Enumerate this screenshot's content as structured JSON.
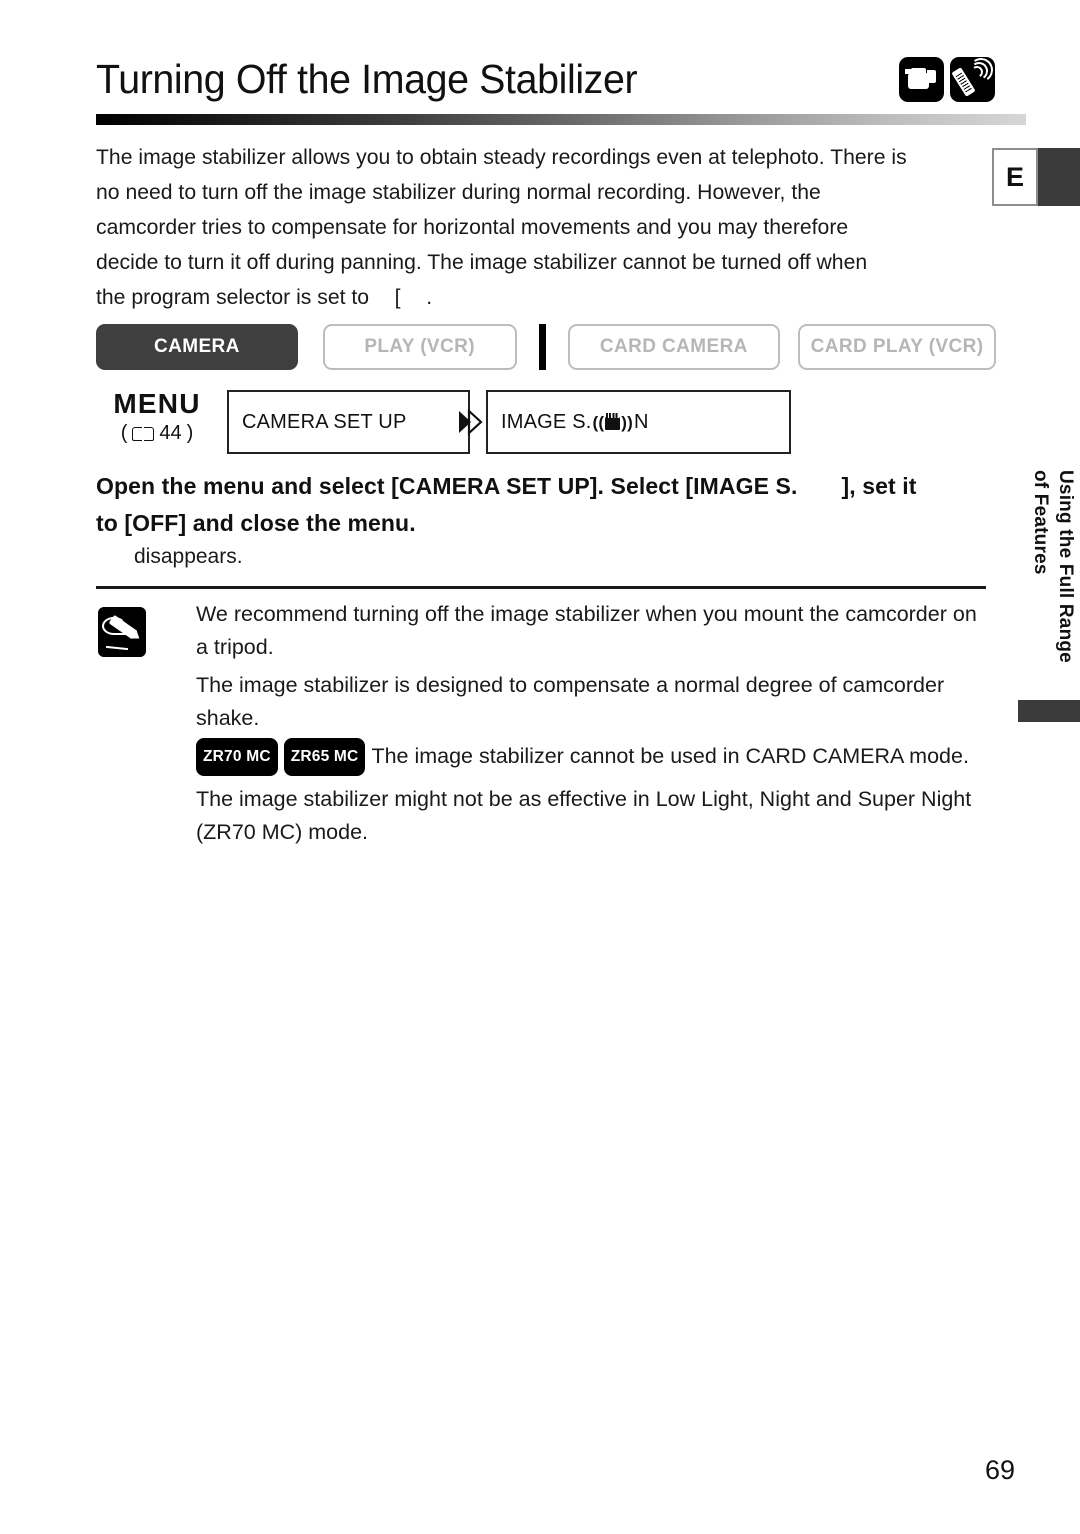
{
  "page": {
    "title": "Turning Off the Image Stabilizer",
    "number": "69",
    "language_tab": "E"
  },
  "title_icons": [
    {
      "name": "camcorder-icon",
      "label": "camcorder"
    },
    {
      "name": "remote-control-icon",
      "label": "wireless remote control"
    }
  ],
  "intro": {
    "line1": "The image stabilizer allows you to obtain steady recordings even at telephoto. There is",
    "line2": "no need to turn off the image stabilizer during normal recording. However, the",
    "line3": "camcorder tries to compensate for horizontal movements and you may therefore",
    "line4": "decide to turn it off during panning. The image stabilizer cannot be turned off when",
    "line5_before": "the program selector is set to",
    "line5_after": "[",
    "line5_end": "."
  },
  "mode_bar": {
    "modes": [
      {
        "label": "CAMERA",
        "state": "active"
      },
      {
        "label": "PLAY (VCR)",
        "state": "inactive"
      },
      {
        "label": "CARD CAMERA",
        "state": "inactive"
      },
      {
        "label": "CARD PLAY (VCR)",
        "state": "inactive"
      }
    ]
  },
  "menu": {
    "word": "MENU",
    "ref_open": "(",
    "ref_page": "44",
    "ref_close": ")",
    "box1": "CAMERA SET UP",
    "box2_before": "IMAGE S",
    "box2_dot": ".",
    "box2_after": "N"
  },
  "instruction": {
    "part1": "Open the menu and select [CAMERA SET UP]. Select [IMAGE S.",
    "part2": "], set it",
    "part3": "to [OFF] and close the menu.",
    "sub": "disappears."
  },
  "notes": {
    "icon_label": "note-pencil",
    "items": [
      {
        "badges": [],
        "text": "We recommend turning off the image stabilizer when you mount the camcorder on a tripod."
      },
      {
        "badges": [],
        "text": "The image stabilizer is designed to compensate a normal degree of camcorder shake."
      },
      {
        "badges": [
          "ZR70 MC",
          "ZR65 MC"
        ],
        "text": "The image stabilizer cannot be used in CARD CAMERA mode."
      },
      {
        "badges": [],
        "text": "The image stabilizer might not be as effective in Low Light, Night and Super Night (ZR70 MC) mode."
      }
    ]
  },
  "side_tab": {
    "line1": "Using the Full Range",
    "line2": "of Features"
  },
  "colors": {
    "accent_dark": "#3b3b3b",
    "inactive_gray": "#b6b6b6",
    "border_gray": "#bdbdbd",
    "text": "#1a1a1a"
  }
}
